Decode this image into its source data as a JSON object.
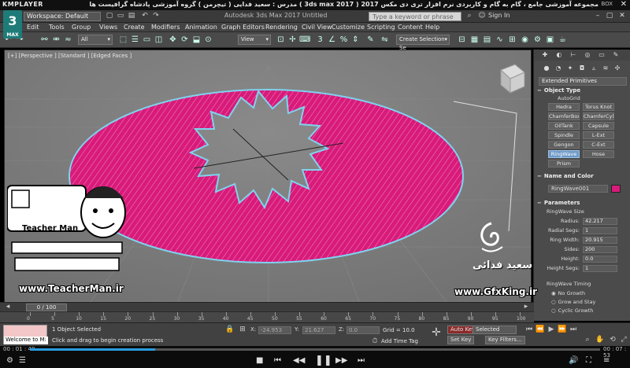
{
  "player": {
    "logo": "KMPLAYER",
    "title": "مجموعه آموزشی جامع ، گام به گام و کاربردی نرم افزار تری دی مکس 2017  ( 3ds max 2017 )  مدرس : سعید فدایی ( تیچرمن ) گروه آموزشی پادشاه گرافیست ها",
    "box_label": "BOX",
    "close_icon": "✕",
    "time_current": "00 : 01 : 40",
    "time_total": "00 : 07 : 53",
    "progress": 0.22
  },
  "app": {
    "logo": "3",
    "logo_sub": "MAX",
    "workspace": "Workspace: Default",
    "title": "Autodesk 3ds Max 2017     Untitled",
    "search_placeholder": "Type a keyword or phrase",
    "sign_in": "Sign In"
  },
  "menu": [
    "Edit",
    "Tools",
    "Group",
    "Views",
    "Create",
    "Modifiers",
    "Animation",
    "Graph Editors",
    "Rendering",
    "Civil View",
    "Customize",
    "Scripting",
    "Content",
    "Help"
  ],
  "toolbar": {
    "filter": "All",
    "ref_coord": "View",
    "selection_set": "Create Selection Se"
  },
  "viewport": {
    "label": "[+] [Perspective ] [Standard ] [Edged Faces ]",
    "object_color": "#d81b7a",
    "selection_color": "#7fd3f0"
  },
  "watermark": {
    "teacher_name": "Teacher Man",
    "teacher_url": "www.TeacherMan.ir",
    "gfx_name": "سعید فدائی",
    "gfx_url": "www.GfxKing.ir"
  },
  "command_panel": {
    "category": "Extended Primitives",
    "object_type_title": "Object Type",
    "autogrid": "AutoGrid",
    "buttons": [
      "Hedra",
      "Torus Knot",
      "ChamferBox",
      "ChamferCyl",
      "OilTank",
      "Capsule",
      "Spindle",
      "L-Ext",
      "Gengon",
      "C-Ext",
      "RingWave",
      "Hose",
      "Prism"
    ],
    "active_button": "RingWave",
    "name_color_title": "Name and Color",
    "object_name": "RingWave001",
    "parameters_title": "Parameters",
    "ringwave_size": "RingWave Size",
    "params": [
      {
        "label": "Radius:",
        "value": "42.217"
      },
      {
        "label": "Radial Segs:",
        "value": "1"
      },
      {
        "label": "Ring Width:",
        "value": "20.915"
      },
      {
        "label": "Sides:",
        "value": "200"
      },
      {
        "label": "Height:",
        "value": "0.0"
      },
      {
        "label": "Height Segs:",
        "value": "1"
      }
    ],
    "timing_title": "RingWave Timing",
    "timing_options": [
      "No Growth",
      "Grow and Stay",
      "Cyclic Growth"
    ],
    "timing_selected": "No Growth"
  },
  "timeline": {
    "slider": "0 / 100",
    "ticks": [
      "0",
      "5",
      "10",
      "15",
      "20",
      "25",
      "30",
      "35",
      "40",
      "45",
      "50",
      "55",
      "60",
      "65",
      "70",
      "75",
      "80",
      "85",
      "90",
      "95",
      "100"
    ]
  },
  "status": {
    "maxscript": "Welcome to M:",
    "selected": "1 Object Selected",
    "prompt": "Click and drag to begin creation process",
    "x_label": "X:",
    "x_value": "-24.953",
    "y_label": "Y:",
    "y_value": "21.627",
    "z_label": "Z:",
    "z_value": "0.0",
    "grid": "Grid = 10.0",
    "add_time_tag": "Add Time Tag",
    "auto_key": "Auto Key",
    "set_key": "Set Key",
    "selected_dd": "Selected",
    "key_filters": "Key Filters..."
  }
}
